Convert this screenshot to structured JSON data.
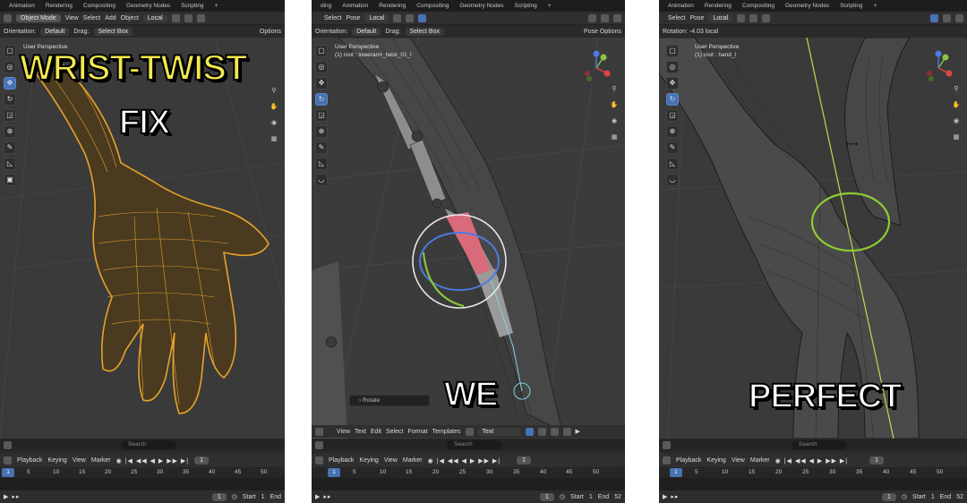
{
  "panel1": {
    "tabs": [
      "Animation",
      "Rendering",
      "Compositing",
      "Geometry Nodes",
      "Scripting",
      "+"
    ],
    "header": {
      "mode": "Object Mode",
      "menus": [
        "View",
        "Select",
        "Add",
        "Object"
      ],
      "transform": "Local"
    },
    "toolopts": {
      "orientation_label": "Orientation:",
      "orientation": "Default",
      "drag_label": "Drag:",
      "drag": "Select Box",
      "options": "Options"
    },
    "viewport": {
      "line1": "User Perspective"
    },
    "overlay": {
      "line1": "WRIST-TWIST",
      "line2": "FIX"
    },
    "search_placeholder": "Search",
    "timeline": {
      "menus": [
        "Playback",
        "Keying",
        "View",
        "Marker"
      ],
      "current_frame": "1",
      "ticks": [
        "5",
        "10",
        "15",
        "20",
        "25",
        "30",
        "35",
        "40",
        "45",
        "50"
      ],
      "cur": "1"
    },
    "footer": {
      "frame": "1",
      "start_label": "Start",
      "start": "1",
      "end_label": "End"
    }
  },
  "panel2": {
    "tabs": [
      "ding",
      "Animation",
      "Rendering",
      "Compositing",
      "Geometry Nodes",
      "Scripting",
      "+"
    ],
    "header": {
      "menus": [
        "Select",
        "Pose"
      ],
      "transform": "Local"
    },
    "toolopts": {
      "orientation_label": "Orientation:",
      "orientation": "Default",
      "drag_label": "Drag:",
      "drag": "Select Box",
      "options": "Pose Options"
    },
    "viewport": {
      "line1": "User Perspective",
      "line2": "(1) root : lowerarm_twist_01_l"
    },
    "rotate_label": "Rotate",
    "overlay": {
      "line1": "WE"
    },
    "text_editor": {
      "menus": [
        "View",
        "Text",
        "Edit",
        "Select",
        "Format",
        "Templates"
      ],
      "name": "Text"
    },
    "search_placeholder": "Search",
    "timeline": {
      "menus": [
        "Playback",
        "Keying",
        "View",
        "Marker"
      ],
      "current_frame": "1",
      "ticks": [
        "5",
        "10",
        "15",
        "20",
        "25",
        "30",
        "35",
        "40",
        "45",
        "50"
      ],
      "cur": "1"
    },
    "footer": {
      "frame": "1",
      "start_label": "Start",
      "start": "1",
      "end_label": "End",
      "end": "52"
    }
  },
  "panel3": {
    "tabs": [
      "Animation",
      "Rendering",
      "Compositing",
      "Geometry Nodes",
      "Scripting",
      "+"
    ],
    "header": {
      "menus": [
        "Select",
        "Pose"
      ],
      "transform": "Local"
    },
    "rotation_info": "Rotation: -4.03 local",
    "viewport": {
      "line1": "User Perspective",
      "line2": "(1) root : hand_l"
    },
    "overlay": {
      "line1": "PERFECT"
    },
    "search_placeholder": "Search",
    "timeline": {
      "menus": [
        "Playback",
        "Keying",
        "View",
        "Marker"
      ],
      "current_frame": "1",
      "ticks": [
        "5",
        "10",
        "15",
        "20",
        "25",
        "30",
        "35",
        "40",
        "45",
        "50"
      ],
      "cur": "1"
    },
    "footer": {
      "frame": "1",
      "start_label": "Start",
      "start": "1",
      "end_label": "End",
      "end": "52"
    }
  },
  "colors": {
    "wireframe": "#e6a329",
    "selected_bone": "#7fd3e0",
    "accent": "#4772b3",
    "rotate_ring": "#8fcc33"
  }
}
